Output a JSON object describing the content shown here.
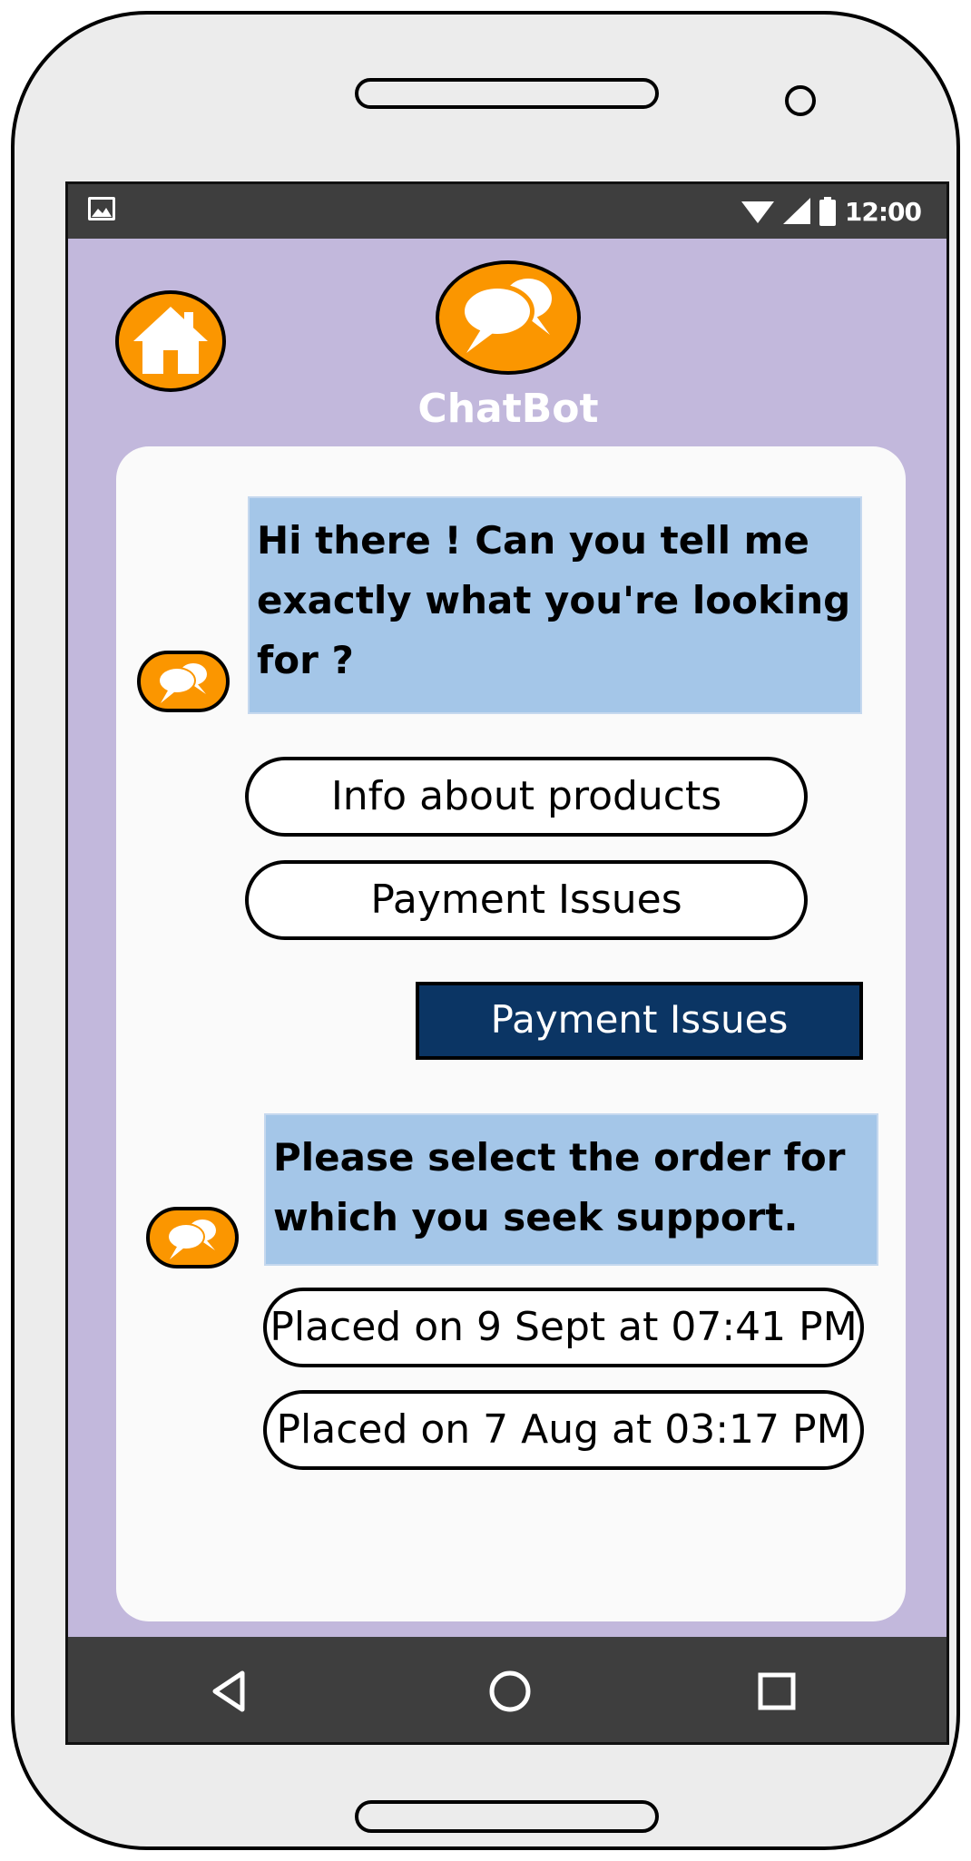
{
  "status_bar": {
    "time": "12:00"
  },
  "header": {
    "title": "ChatBot"
  },
  "chat": {
    "bot_message_1": {
      "line1": "Hi there ! Can you tell me",
      "line2": "exactly what you're looking",
      "line3": "for ?"
    },
    "options_1": [
      "Info about products",
      "Payment Issues"
    ],
    "user_reply": "Payment Issues",
    "bot_message_2": {
      "line1": "Please select the order for",
      "line2": "which you seek support."
    },
    "options_2": [
      "Placed on 9 Sept at 07:41 PM",
      "Placed on 7 Aug at 03:17 PM"
    ]
  },
  "colors": {
    "accent_orange": "#fb9600",
    "screen_background": "#c2b8dc",
    "bot_bubble": "#a4c6e8",
    "user_bubble": "#0b3564",
    "system_bars": "#3e3e3e"
  },
  "icons": [
    "image-icon",
    "wifi-icon",
    "signal-icon",
    "battery-icon",
    "home-icon",
    "chat-bubbles-icon",
    "back-icon",
    "home-nav-icon",
    "recents-icon"
  ]
}
